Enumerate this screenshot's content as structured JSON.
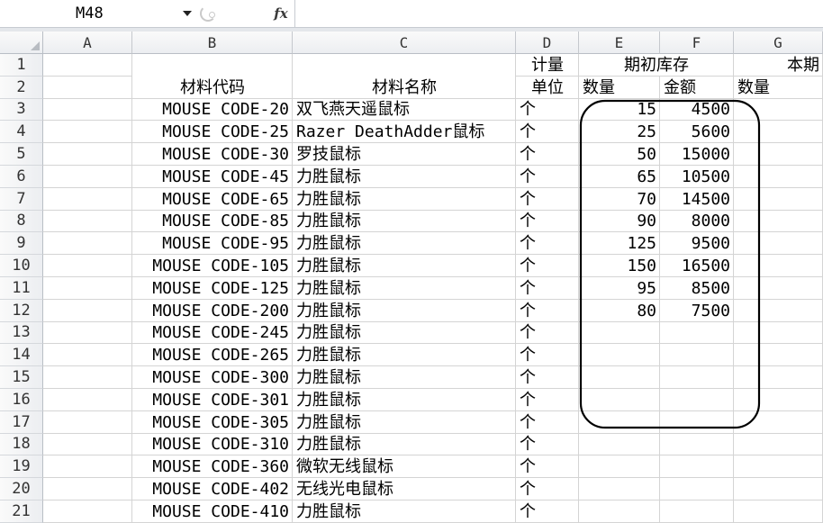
{
  "formula_bar": {
    "name_box": "M48",
    "fx_label": "fx",
    "formula": "",
    "icons": {
      "name_box_dropdown": "chevron-down-icon",
      "splitter": "splitter-icon"
    }
  },
  "column_headers": [
    "A",
    "B",
    "C",
    "D",
    "E",
    "F",
    "G"
  ],
  "row_headers": [
    "1",
    "2",
    "3",
    "4",
    "5",
    "6",
    "7",
    "8",
    "9",
    "10",
    "11",
    "12",
    "13",
    "14",
    "15",
    "16",
    "17",
    "18",
    "19",
    "20",
    "21"
  ],
  "table_header": {
    "code": "材料代码",
    "name": "材料名称",
    "unit_line1": "计量",
    "unit_line2": "单位",
    "opening_stock": "期初库存",
    "opening_qty": "数量",
    "opening_amount": "金额",
    "current_period": "本期",
    "current_qty": "数量"
  },
  "rows": [
    {
      "code": "MOUSE CODE-20",
      "name": "双飞燕天遥鼠标",
      "unit": "个",
      "qty": 15,
      "amount": 4500
    },
    {
      "code": "MOUSE CODE-25",
      "name": "Razer DeathAdder鼠标",
      "unit": "个",
      "qty": 25,
      "amount": 5600
    },
    {
      "code": "MOUSE CODE-30",
      "name": "罗技鼠标",
      "unit": "个",
      "qty": 50,
      "amount": 15000
    },
    {
      "code": "MOUSE CODE-45",
      "name": "力胜鼠标",
      "unit": "个",
      "qty": 65,
      "amount": 10500
    },
    {
      "code": "MOUSE CODE-65",
      "name": "力胜鼠标",
      "unit": "个",
      "qty": 70,
      "amount": 14500
    },
    {
      "code": "MOUSE CODE-85",
      "name": "力胜鼠标",
      "unit": "个",
      "qty": 90,
      "amount": 8000
    },
    {
      "code": "MOUSE CODE-95",
      "name": "力胜鼠标",
      "unit": "个",
      "qty": 125,
      "amount": 9500
    },
    {
      "code": "MOUSE CODE-105",
      "name": "力胜鼠标",
      "unit": "个",
      "qty": 150,
      "amount": 16500
    },
    {
      "code": "MOUSE CODE-125",
      "name": "力胜鼠标",
      "unit": "个",
      "qty": 95,
      "amount": 8500
    },
    {
      "code": "MOUSE CODE-200",
      "name": "力胜鼠标",
      "unit": "个",
      "qty": 80,
      "amount": 7500
    },
    {
      "code": "MOUSE CODE-245",
      "name": "力胜鼠标",
      "unit": "个"
    },
    {
      "code": "MOUSE CODE-265",
      "name": "力胜鼠标",
      "unit": "个"
    },
    {
      "code": "MOUSE CODE-300",
      "name": "力胜鼠标",
      "unit": "个"
    },
    {
      "code": "MOUSE CODE-301",
      "name": "力胜鼠标",
      "unit": "个"
    },
    {
      "code": "MOUSE CODE-305",
      "name": "力胜鼠标",
      "unit": "个"
    },
    {
      "code": "MOUSE CODE-310",
      "name": "力胜鼠标",
      "unit": "个"
    },
    {
      "code": "MOUSE CODE-360",
      "name": "微软无线鼠标",
      "unit": "个"
    },
    {
      "code": "MOUSE CODE-402",
      "name": "无线光电鼠标",
      "unit": "个"
    },
    {
      "code": "MOUSE CODE-410",
      "name": "力胜鼠标",
      "unit": "个"
    }
  ],
  "colors": {
    "gridline": "#d4d4d4",
    "annotation_outline": "#000000"
  }
}
